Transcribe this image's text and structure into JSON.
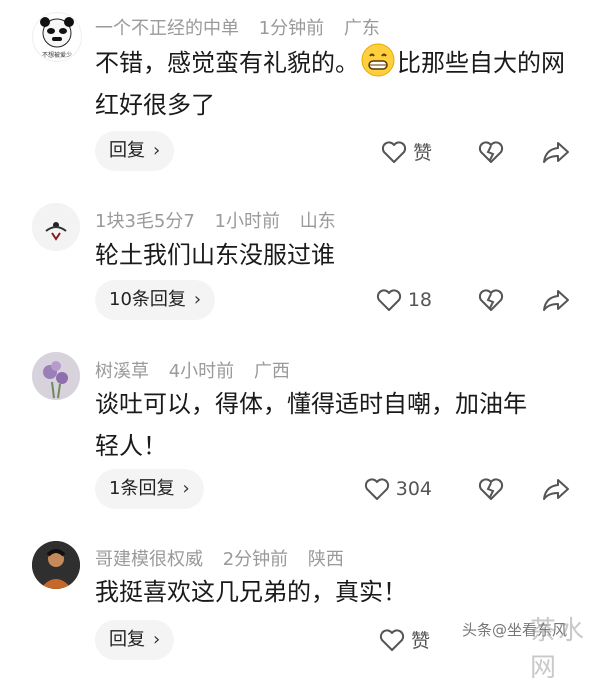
{
  "comments": [
    {
      "username": "一个不正经的中单",
      "time": "1分钟前",
      "location": "广东",
      "text_part1": "不错，感觉蛮有礼貌的。",
      "text_part2": "比那些自大的网红好很多了",
      "reply_label": "回复",
      "like_label": "赞",
      "avatar_caption": "不想被爱少"
    },
    {
      "username": "1块3毛5分7",
      "time": "1小时前",
      "location": "山东",
      "text": "轮土我们山东没服过谁",
      "reply_label": "10条回复",
      "like_label": "18"
    },
    {
      "username": "树溪草",
      "time": "4小时前",
      "location": "广西",
      "text": "谈吐可以，得体，懂得适时自嘲，加油年轻人！",
      "reply_label": "1条回复",
      "like_label": "304"
    },
    {
      "username": "哥建模很权威",
      "time": "2分钟前",
      "location": "陕西",
      "text": "我挺喜欢这几兄弟的，真实！",
      "reply_label": "回复",
      "like_label": "赞"
    }
  ],
  "watermark": {
    "text": "头条@坐看东风",
    "logo": "茶水网"
  },
  "colors": {
    "meta": "#9a9a9a",
    "reply_bg": "#f4f4f4",
    "icon": "#555555"
  }
}
